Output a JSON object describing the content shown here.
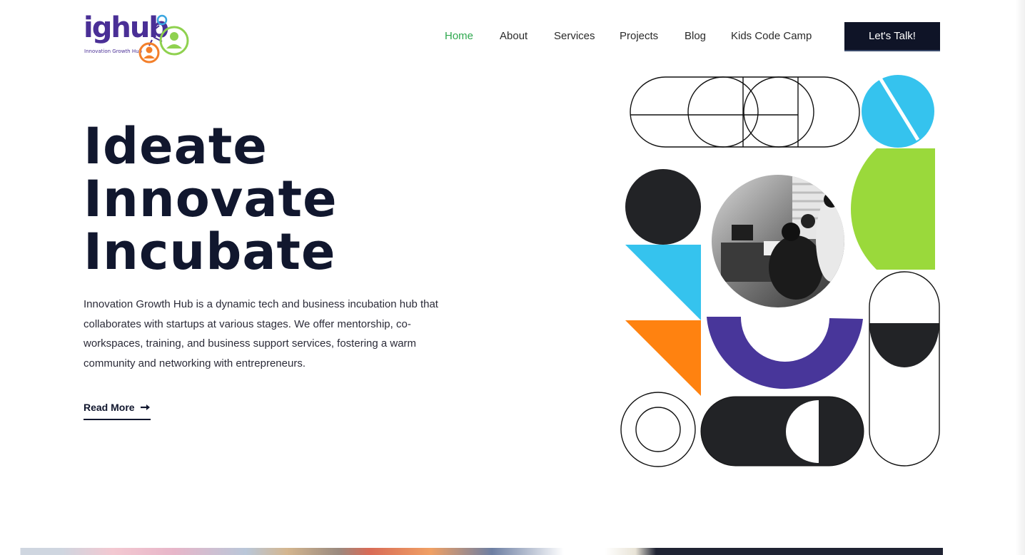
{
  "header": {
    "logo": {
      "wordmark": "ighub",
      "tagline": "Innovation Growth Hub"
    },
    "nav": [
      {
        "label": "Home",
        "active": true
      },
      {
        "label": "About",
        "active": false
      },
      {
        "label": "Services",
        "active": false
      },
      {
        "label": "Projects",
        "active": false
      },
      {
        "label": "Blog",
        "active": false
      },
      {
        "label": "Kids Code Camp",
        "active": false
      }
    ],
    "cta_label": "Let's Talk!"
  },
  "hero": {
    "title_lines": [
      "Ideate",
      "Innovate",
      "Incubate"
    ],
    "description": "Innovation Growth Hub is a dynamic tech and business incubation hub that collaborates with startups at various stages. We offer mentorship, co-workspaces, training, and business support services, fostering a warm community and networking with entrepreneurs.",
    "read_more_label": "Read More",
    "read_more_icon": "arrow-right-icon"
  },
  "colors": {
    "accent_green": "#2fa84f",
    "navy": "#11172e",
    "button_bg": "#0f1427",
    "shape_blue": "#35c3ee",
    "shape_lime": "#9ad93b",
    "shape_orange": "#ff8210",
    "shape_purple": "#48369a",
    "shape_dark": "#222326",
    "logo_purple": "#4a2f96",
    "logo_orange": "#f37f2a",
    "logo_green": "#8fd14f",
    "logo_blue": "#3aa6e0"
  }
}
